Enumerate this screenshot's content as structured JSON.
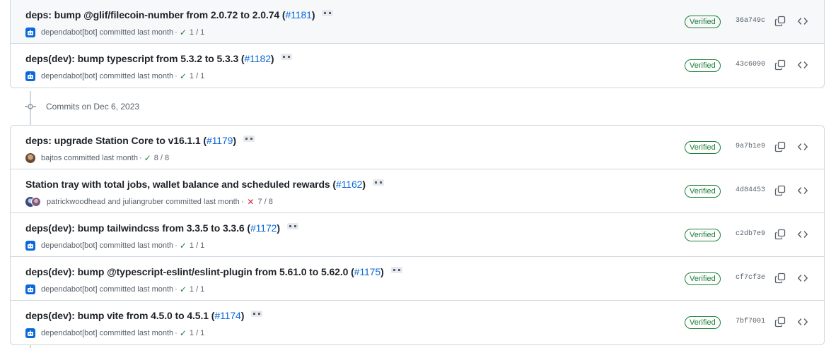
{
  "colors": {
    "accent": "#0969da",
    "success": "#1a7f37",
    "danger": "#cf222e",
    "border": "#d0d7de",
    "muted": "#57606a"
  },
  "day_header": {
    "label": "Commits on Dec 6, 2023"
  },
  "group1": [
    {
      "title": "deps: bump @glif/filecoin-number from 2.0.72 to 2.0.74 (",
      "pr": "#1181",
      "close": ")",
      "avatar": "bot-icon",
      "author": "dependabot[bot]",
      "action": "committed",
      "time": "last month",
      "sep": "·",
      "status": "success",
      "checks": "1 / 1",
      "verified": "Verified",
      "sha": "36a749c"
    },
    {
      "title": "deps(dev): bump typescript from 5.3.2 to 5.3.3 (",
      "pr": "#1182",
      "close": ")",
      "avatar": "bot-icon",
      "author": "dependabot[bot]",
      "action": "committed",
      "time": "last month",
      "sep": "·",
      "status": "success",
      "checks": "1 / 1",
      "verified": "Verified",
      "sha": "43c6090"
    }
  ],
  "group2": [
    {
      "title": "deps: upgrade Station Core to v16.1.1 (",
      "pr": "#1179",
      "close": ")",
      "avatar": "person",
      "author": "bajtos",
      "action": "committed",
      "time": "last month",
      "sep": "·",
      "status": "success",
      "checks": "8 / 8",
      "verified": "Verified",
      "sha": "9a7b1e9"
    },
    {
      "title": "Station tray with total jobs, wallet balance and scheduled rewards (",
      "pr": "#1162",
      "close": ")",
      "avatar": "pair",
      "author": "patrickwoodhead and juliangruber",
      "action": "committed",
      "time": "last month",
      "sep": "·",
      "status": "failure",
      "checks": "7 / 8",
      "verified": "Verified",
      "sha": "4d84453"
    },
    {
      "title": "deps(dev): bump tailwindcss from 3.3.5 to 3.3.6 (",
      "pr": "#1172",
      "close": ")",
      "avatar": "bot-icon",
      "author": "dependabot[bot]",
      "action": "committed",
      "time": "last month",
      "sep": "·",
      "status": "success",
      "checks": "1 / 1",
      "verified": "Verified",
      "sha": "c2db7e9"
    },
    {
      "title": "deps(dev): bump @typescript-eslint/eslint-plugin from 5.61.0 to 5.62.0 (",
      "pr": "#1175",
      "close": ")",
      "avatar": "bot-icon",
      "author": "dependabot[bot]",
      "action": "committed",
      "time": "last month",
      "sep": "·",
      "status": "success",
      "checks": "1 / 1",
      "verified": "Verified",
      "sha": "cf7cf3e"
    },
    {
      "title": "deps(dev): bump vite from 4.5.0 to 4.5.1 (",
      "pr": "#1174",
      "close": ")",
      "avatar": "bot-icon",
      "author": "dependabot[bot]",
      "action": "committed",
      "time": "last month",
      "sep": "·",
      "status": "success",
      "checks": "1 / 1",
      "verified": "Verified",
      "sha": "7bf7001"
    }
  ]
}
